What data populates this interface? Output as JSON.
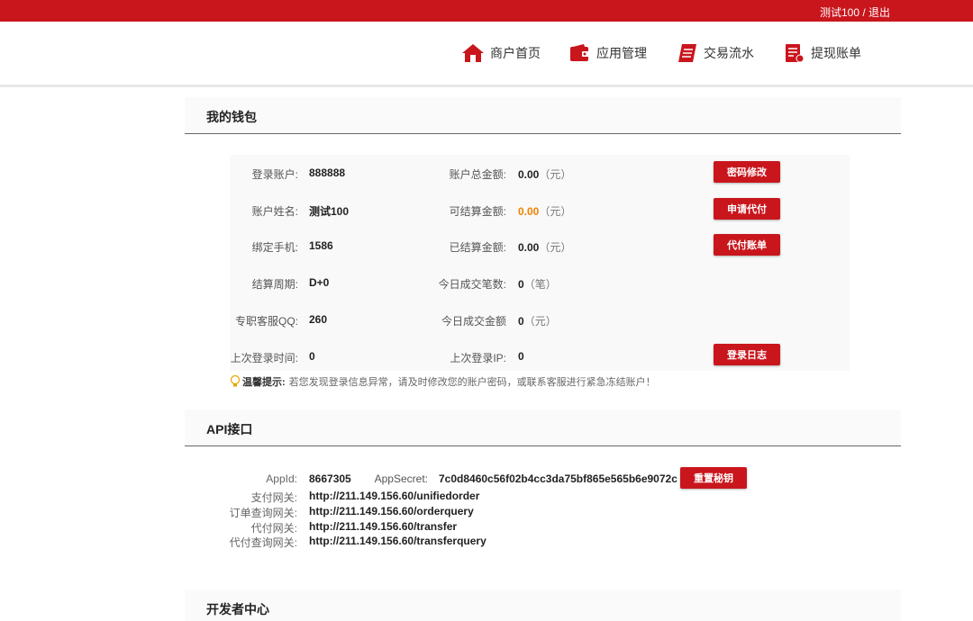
{
  "topbar": {
    "user": "测试100 / 退出"
  },
  "nav": {
    "items": [
      {
        "label": "商户首页",
        "icon": "home-icon"
      },
      {
        "label": "应用管理",
        "icon": "wallet-icon"
      },
      {
        "label": "交易流水",
        "icon": "notebook-icon"
      },
      {
        "label": "提现账单",
        "icon": "document-icon"
      }
    ]
  },
  "wallet": {
    "title": "我的钱包",
    "left": [
      {
        "label": "登录账户:",
        "value": "888888"
      },
      {
        "label": "账户姓名:",
        "value": "测试100"
      },
      {
        "label": "绑定手机:",
        "value": "1586"
      },
      {
        "label": "结算周期:",
        "value": "D+0"
      },
      {
        "label": "专职客服QQ:",
        "value": "260"
      },
      {
        "label": "上次登录时间:",
        "value": "0"
      }
    ],
    "right": [
      {
        "label": "账户总金额:",
        "value": "0.00",
        "unit": "（元）"
      },
      {
        "label": "可结算金额:",
        "value": "0.00",
        "unit": "（元）"
      },
      {
        "label": "已结算金额:",
        "value": "0.00",
        "unit": "（元）"
      },
      {
        "label": "今日成交笔数:",
        "value": "0",
        "unit": "（笔）"
      },
      {
        "label": "今日成交金额",
        "value": "0",
        "unit": "（元）"
      },
      {
        "label": "上次登录IP:",
        "value": "0",
        "unit": ""
      }
    ],
    "buttons": {
      "change_password": "密码修改",
      "apply_payout": "申请代付",
      "payout_bill": "代付账单",
      "login_log": "登录日志"
    },
    "tip_label": "温馨提示:",
    "tip_text": "若您发现登录信息异常，请及时修改您的账户密码，或联系客服进行紧急冻结账户！"
  },
  "api": {
    "title": "API接口",
    "appid_label": "AppId:",
    "appid": "8667305",
    "secret_label": "AppSecret:",
    "secret": "7c0d8460c56f02b4cc3da75bf865e565b6e9072c",
    "reset_button": "重置秘钥",
    "gateways": [
      {
        "label": "支付网关:",
        "url": "http://211.149.156.60/unifiedorder"
      },
      {
        "label": "订单查询网关:",
        "url": "http://211.149.156.60/orderquery"
      },
      {
        "label": "代付网关:",
        "url": "http://211.149.156.60/transfer"
      },
      {
        "label": "代付查询网关:",
        "url": "http://211.149.156.60/transferquery"
      }
    ]
  },
  "developer": {
    "title": "开发者中心"
  },
  "colors": {
    "brand": "#c9161d",
    "highlight": "#f08200"
  }
}
